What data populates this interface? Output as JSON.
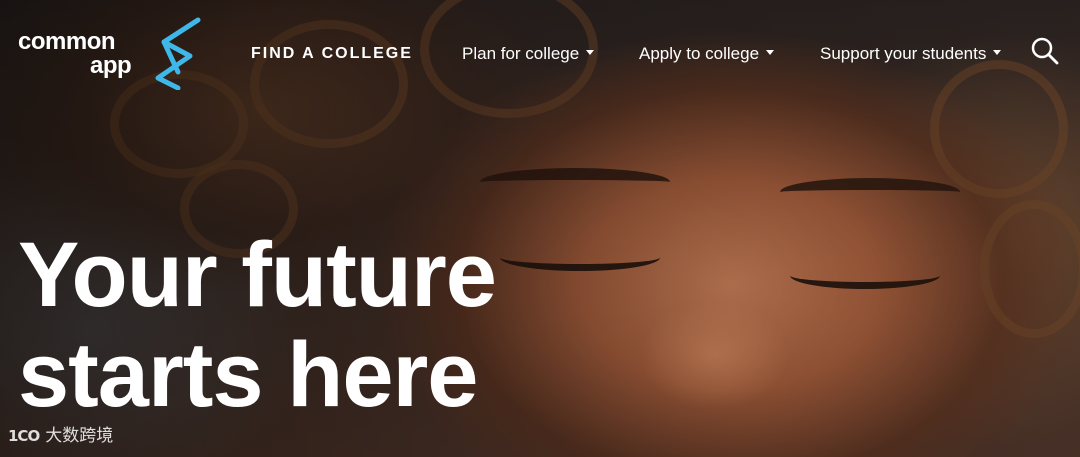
{
  "logo": {
    "line1": "common",
    "line2": "app",
    "accent_color": "#3fb7e8"
  },
  "nav": {
    "find_college": "FIND A COLLEGE",
    "plan": "Plan for college",
    "apply": "Apply to college",
    "support": "Support your students",
    "search_icon": "search-icon",
    "caret_icon": "caret-down-icon"
  },
  "hero": {
    "line1": "Your future",
    "line2": "starts here"
  },
  "watermark": {
    "logo": "1CO",
    "text": "大数跨境"
  }
}
